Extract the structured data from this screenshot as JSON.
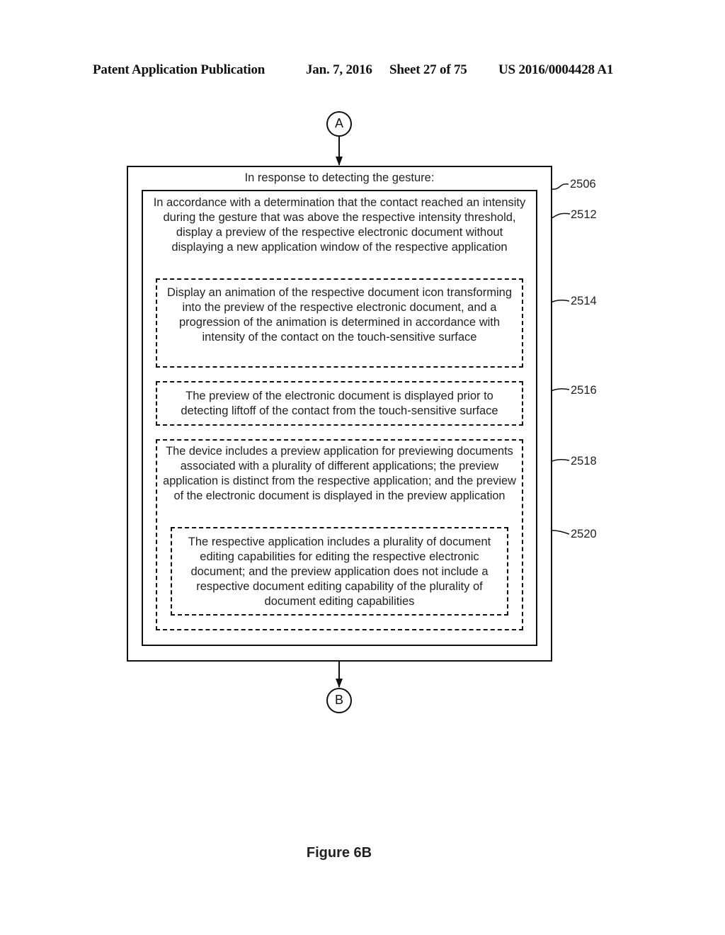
{
  "header": {
    "publication": "Patent Application Publication",
    "date": "Jan. 7, 2016",
    "sheet": "Sheet 27 of 75",
    "number": "US 2016/0004428 A1"
  },
  "connectors": {
    "top": "A",
    "bottom": "B"
  },
  "boxes": {
    "outer": {
      "ref": "2506",
      "text": "In response to detecting the gesture:"
    },
    "b2512": {
      "ref": "2512",
      "text": "In accordance with a determination that the contact reached an intensity during the gesture that was above the respective intensity threshold, display a preview of the respective electronic document without displaying a new application window of the respective application"
    },
    "b2514": {
      "ref": "2514",
      "text": "Display an animation of the respective document icon transforming into the preview of the respective electronic document, and a progression of the animation is determined in accordance with intensity of the contact on the touch-sensitive surface"
    },
    "b2516": {
      "ref": "2516",
      "text": "The preview of the electronic document is displayed prior to detecting liftoff of the contact from the touch-sensitive surface"
    },
    "b2518": {
      "ref": "2518",
      "text": "The device includes a preview application for previewing documents associated with a plurality of different applications; the preview application is distinct from the respective application; and the preview of the electronic document is displayed in the preview application"
    },
    "b2520": {
      "ref": "2520",
      "text": "The respective application includes a plurality of document editing capabilities for editing the respective electronic document; and the preview application does not include a respective document editing capability of the plurality of document editing capabilities"
    }
  },
  "figure_label": "Figure 6B"
}
